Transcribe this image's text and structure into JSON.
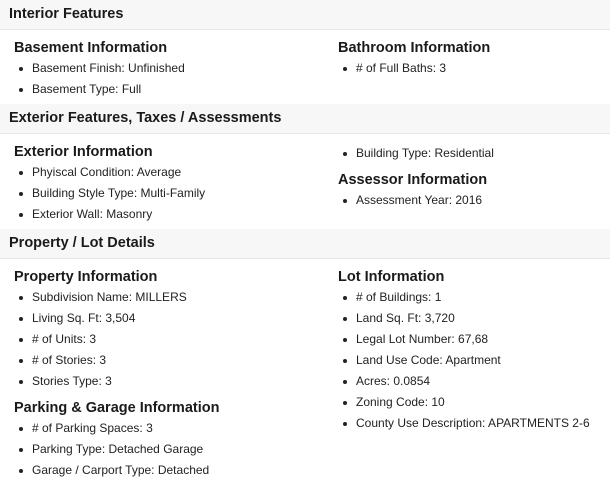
{
  "sections": [
    {
      "title": "Interior Features",
      "left": [
        {
          "title": "Basement Information",
          "items": [
            "Basement Finish: Unfinished",
            "Basement Type: Full"
          ]
        }
      ],
      "right": [
        {
          "title": "Bathroom Information",
          "items": [
            "# of Full Baths: 3"
          ]
        }
      ]
    },
    {
      "title": "Exterior Features, Taxes / Assessments",
      "left": [
        {
          "title": "Exterior Information",
          "items": [
            "Phyiscal Condition: Average",
            "Building Style Type: Multi-Family",
            "Exterior Wall: Masonry"
          ]
        }
      ],
      "right": [
        {
          "title": "",
          "items": [
            "Building Type: Residential"
          ]
        },
        {
          "title": "Assessor Information",
          "items": [
            "Assessment Year: 2016"
          ]
        }
      ]
    },
    {
      "title": "Property / Lot Details",
      "left": [
        {
          "title": "Property Information",
          "items": [
            "Subdivision Name: MILLERS",
            "Living Sq. Ft: 3,504",
            "# of Units: 3",
            "# of Stories: 3",
            "Stories Type: 3"
          ]
        },
        {
          "title": "Parking & Garage Information",
          "items": [
            "# of Parking Spaces: 3",
            "Parking Type: Detached Garage",
            "Garage / Carport Type: Detached"
          ]
        }
      ],
      "right": [
        {
          "title": "Lot Information",
          "items": [
            "# of Buildings: 1",
            "Land Sq. Ft: 3,720",
            "Legal Lot Number: 67,68",
            "Land Use Code: Apartment",
            "Acres: 0.0854",
            "Zoning Code: 10",
            "County Use Description: APARTMENTS 2-6"
          ]
        }
      ]
    }
  ]
}
